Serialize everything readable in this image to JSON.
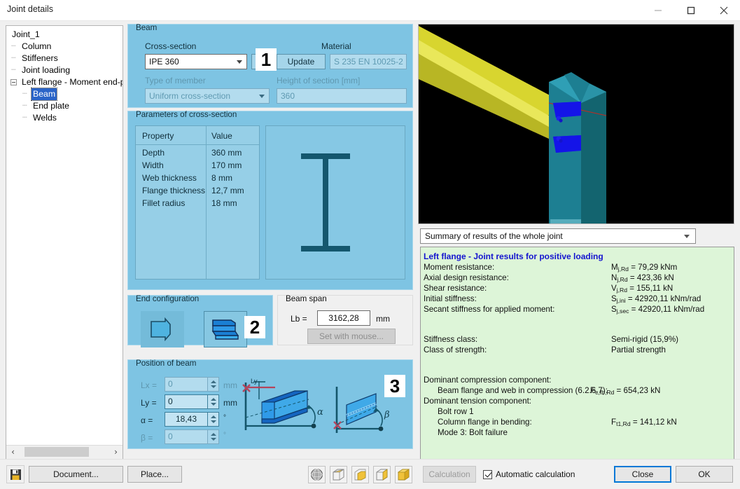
{
  "window": {
    "title": "Joint details",
    "minimize_label": "minimize",
    "maximize_label": "maximize",
    "close_label": "close"
  },
  "tree": {
    "nodes": [
      {
        "label": "Joint_1",
        "level": 1,
        "selected": false,
        "expander": false
      },
      {
        "label": "Column",
        "level": 2,
        "selected": false,
        "expander": false
      },
      {
        "label": "Stiffeners",
        "level": 2,
        "selected": false,
        "expander": false
      },
      {
        "label": "Joint loading",
        "level": 2,
        "selected": false,
        "expander": false
      },
      {
        "label": "Left flange - Moment end-pl",
        "level": 2,
        "selected": false,
        "expander": true
      },
      {
        "label": "Beam",
        "level": 3,
        "selected": true,
        "expander": false
      },
      {
        "label": "End plate",
        "level": 3,
        "selected": false,
        "expander": false
      },
      {
        "label": "Welds",
        "level": 3,
        "selected": false,
        "expander": false
      }
    ],
    "scroll_left_arrow": "‹",
    "scroll_right_arrow": "›"
  },
  "beam_panel": {
    "legend": "Beam",
    "badge": "1",
    "cross_section_label": "Cross-section",
    "cross_section_value": "IPE 360",
    "browse_button": "...",
    "material_label": "Material",
    "update_button": "Update",
    "material_value": "S 235 EN 10025-2",
    "type_of_member_label": "Type of member",
    "type_of_member_value": "Uniform cross-section",
    "height_of_section_label": "Height of section [mm]",
    "height_of_section_value": "360"
  },
  "params_panel": {
    "legend": "Parameters of cross-section",
    "headers": [
      "Property",
      "Value"
    ],
    "rows": [
      {
        "property": "Depth",
        "value": "360 mm"
      },
      {
        "property": "Width",
        "value": "170 mm"
      },
      {
        "property": "Web thickness",
        "value": "8 mm"
      },
      {
        "property": "Flange thickness",
        "value": "12,7 mm"
      },
      {
        "property": "Fillet radius",
        "value": "18 mm"
      }
    ],
    "section_preview_name": "i-beam-section-preview"
  },
  "end_configuration": {
    "legend": "End configuration",
    "badge": "2",
    "option_1_name": "end-config-square",
    "option_2_name": "end-config-bevel"
  },
  "beam_span": {
    "legend": "Beam span",
    "lb_label": "Lb =",
    "lb_value": "3162,28",
    "unit": "mm",
    "set_with_mouse_button": "Set with mouse..."
  },
  "position_of_beam": {
    "legend": "Position of beam",
    "badge": "3",
    "fields": [
      {
        "label": "Lx =",
        "value": "0",
        "unit": "mm",
        "enabled": false
      },
      {
        "label": "Ly =",
        "value": "0",
        "unit": "mm",
        "enabled": true
      },
      {
        "label": "α =",
        "value": "18,43",
        "unit": "°",
        "enabled": true
      },
      {
        "label": "β =",
        "value": "0",
        "unit": "°",
        "enabled": false
      }
    ],
    "diagram_labels": {
      "ly": "Ly",
      "alpha": "α",
      "beta": "β"
    }
  },
  "viewport": {
    "name": "3d-joint-viewport",
    "background": "#000000",
    "beam_color": "#e4e13c",
    "column_color": "#2f9fb5",
    "plate_color": "#1f1fee"
  },
  "results": {
    "selector_value": "Summary of results of the whole joint",
    "heading": "Left flange - Joint results for positive loading",
    "rows": [
      {
        "label": "Moment resistance:",
        "value": "Mj,Rd = 79,29 kNm"
      },
      {
        "label": "Axial design resistance:",
        "value": "Nj,Rd = 423,36 kN"
      },
      {
        "label": "Shear resistance:",
        "value": "Vj,Rd = 155,11 kN"
      },
      {
        "label": "Initial stiffness:",
        "value": "Sj,ini = 42920,11 kNm/rad"
      },
      {
        "label": "Secant stiffness for applied moment:",
        "value": "Sj,sec = 42920,11 kNm/rad"
      }
    ],
    "classes": [
      {
        "label": "Stiffness class:",
        "value": "Semi-rigid (15,9%)"
      },
      {
        "label": "Class of strength:",
        "value": "Partial strength"
      }
    ],
    "compression_heading": "Dominant compression component:",
    "compression_line_label": "Beam flange and web in compression (6.2.6.7):",
    "compression_line_value": "Fc,fb,Rd = 654,23 kN",
    "tension_heading": "Dominant tension component:",
    "tension_lines": [
      {
        "label": "Bolt row 1",
        "value": ""
      },
      {
        "label": "Column flange in bending:",
        "value": "Ft1,Rd = 141,12 kN"
      },
      {
        "label": "Mode 3: Bolt failure",
        "value": ""
      }
    ]
  },
  "bottom_bar": {
    "save_icon_name": "save-icon",
    "document_button": "Document...",
    "place_button": "Place...",
    "view_icons": [
      "render-sphere-icon",
      "wireframe-cube-icon",
      "solid-cube-icon",
      "hidden-line-cube-icon",
      "shaded-cube-icon"
    ],
    "calculation_button": "Calculation",
    "automatic_calculation_label": "Automatic calculation",
    "automatic_calculation_checked": true,
    "close_button": "Close",
    "ok_button": "OK"
  }
}
